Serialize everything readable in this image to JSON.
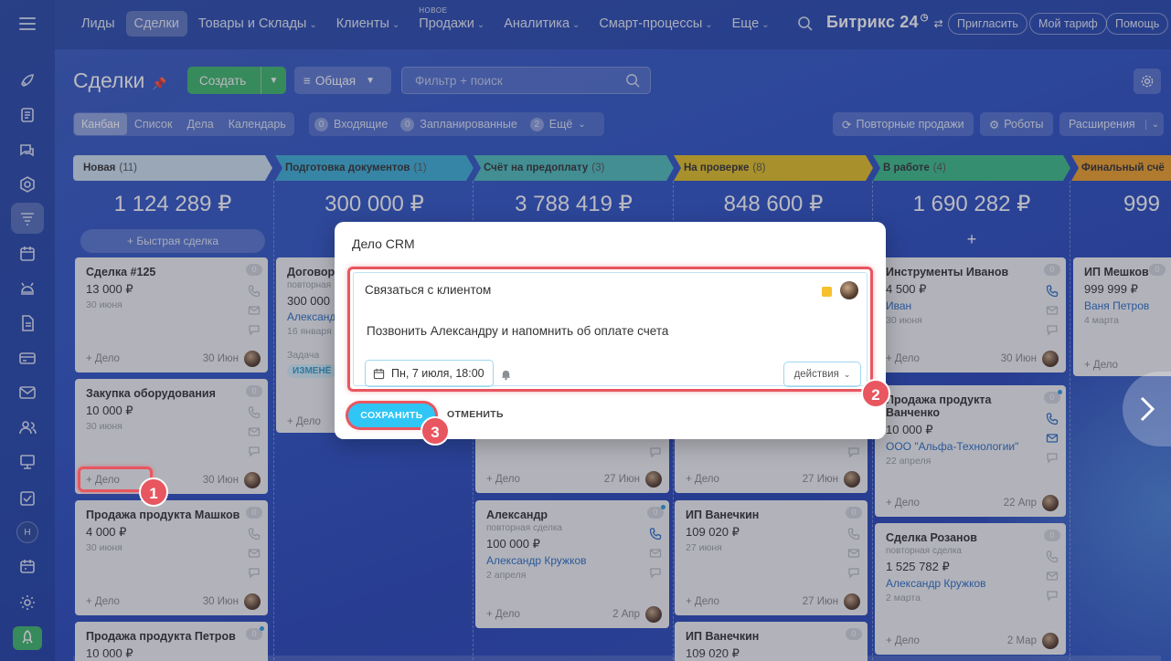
{
  "nav": {
    "items": [
      {
        "label": "Лиды"
      },
      {
        "label": "Сделки",
        "active": true
      },
      {
        "label": "Товары и Склады",
        "chev": "⌄"
      },
      {
        "label": "Клиенты",
        "chev": "⌄"
      },
      {
        "label": "Продажи",
        "chev": "⌄",
        "sup": "НОВОЕ"
      },
      {
        "label": "Аналитика",
        "chev": "⌄"
      },
      {
        "label": "Смарт-процессы",
        "chev": "⌄"
      },
      {
        "label": "Еще",
        "chev": "⌄"
      }
    ],
    "brand": "Битрикс 24",
    "invite": "Пригласить",
    "tariff": "Мой тариф",
    "help": "Помощь"
  },
  "header": {
    "title": "Сделки",
    "create": "Создать",
    "funnel": "Общая",
    "filter_placeholder": "Фильтр + поиск"
  },
  "views": [
    "Канбан",
    "Список",
    "Дела",
    "Календарь"
  ],
  "counters": [
    {
      "n": "0",
      "label": "Входящие"
    },
    {
      "n": "0",
      "label": "Запланированные"
    },
    {
      "n": "2",
      "label": "Ещё"
    }
  ],
  "right_buttons": {
    "repeat": "Повторные продажи",
    "robots": "Роботы",
    "ext": "Расширения"
  },
  "columns": [
    {
      "name": "Новая",
      "count": "(11)",
      "total": "1 124 289 ₽",
      "color": "#cfe3f2",
      "quick": "Быстрая сделка"
    },
    {
      "name": "Подготовка документов",
      "count": "(1)",
      "total": "300 000 ₽",
      "color": "#3fb2d9"
    },
    {
      "name": "Счёт на предоплату",
      "count": "(3)",
      "total": "3 788 419 ₽",
      "color": "#4fbfbd"
    },
    {
      "name": "На проверке",
      "count": "(8)",
      "total": "848 600 ₽",
      "color": "#e5c125"
    },
    {
      "name": "В работе",
      "count": "(4)",
      "total": "1 690 282 ₽",
      "color": "#3dbf8b"
    },
    {
      "name": "Финальный счё",
      "count": "",
      "total": "999",
      "color": "#f0a12a"
    }
  ],
  "cards": {
    "c1": {
      "name": "Сделка #125",
      "sum": "13 000 ₽",
      "date": "30 июня",
      "add": "+ Дело",
      "fdate": "30 Июн",
      "badge": "0"
    },
    "c2": {
      "name": "Закупка оборудования",
      "sum": "10 000 ₽",
      "date": "30 июня",
      "add": "+ Дело",
      "fdate": "30 Июн",
      "badge": "0"
    },
    "c3": {
      "name": "Продажа продукта Машков",
      "sum": "4 000 ₽",
      "date": "30 июня",
      "add": "+ Дело",
      "fdate": "30 Июн",
      "badge": "0"
    },
    "c4": {
      "name": "Продажа продукта Петров",
      "sum": "10 000 ₽",
      "badge": "0"
    },
    "d1": {
      "name": "Договор",
      "sub": "повторная",
      "sum": "300 000",
      "contact": "Александ",
      "date": "16 января",
      "task": "Задача",
      "tag": "ИЗМЕНЁ",
      "add": "+ Дело"
    },
    "s1": {
      "add": "+ Дело",
      "fdate": "27 Июн"
    },
    "s2": {
      "name": "Александр",
      "sub": "повторная сделка",
      "sum": "100 000 ₽",
      "contact": "Александр Кружков",
      "date": "2 апреля",
      "add": "+ Дело",
      "fdate": "2 Апр",
      "badge": "0"
    },
    "p1": {
      "add": "+ Дело",
      "fdate": "27 Июн"
    },
    "p2": {
      "name": "ИП Ванечкин",
      "sum": "109 020 ₽",
      "date": "27 июня",
      "add": "+ Дело",
      "fdate": "27 Июн",
      "badge": "0"
    },
    "p3": {
      "name": "ИП Ванечкин",
      "sum": "109 020 ₽",
      "badge": "0"
    },
    "w1": {
      "name": "Инструменты Иванов",
      "sum": "4 500 ₽",
      "contact": "Иван",
      "date": "30 июня",
      "add": "+ Дело",
      "fdate": "30 Июн",
      "badge": "0"
    },
    "w2": {
      "name": "Продажа продукта Ванченко",
      "sum": "10 000 ₽",
      "contact": "ООО \"Альфа-Технологии\"",
      "date": "22 апреля",
      "add": "+ Дело",
      "fdate": "22 Апр",
      "badge": "0"
    },
    "w3": {
      "name": "Сделка Розанов",
      "sub": "повторная сделка",
      "sum": "1 525 782 ₽",
      "contact": "Александр Кружков",
      "date": "2 марта",
      "add": "+ Дело",
      "fdate": "2 Мар",
      "badge": "0"
    },
    "f1": {
      "name": "ИП Мешков",
      "sum": "999 999 ₽",
      "contact": "Ваня Петров",
      "date": "4 марта",
      "add": "+ Дело",
      "badge": "0"
    }
  },
  "modal": {
    "title": "Дело CRM",
    "subject": "Связаться с клиентом",
    "description": "Позвонить Александру и напомнить об оплате счета",
    "datetime": "Пн, 7 июля, 18:00",
    "actions": "действия",
    "save": "СОХРАНИТЬ",
    "cancel": "ОТМЕНИТЬ"
  },
  "steps": [
    "1",
    "2",
    "3"
  ],
  "colors": {
    "accent": "#2fc6f6",
    "highlight": "#e85660",
    "create": "#3fb86a"
  }
}
